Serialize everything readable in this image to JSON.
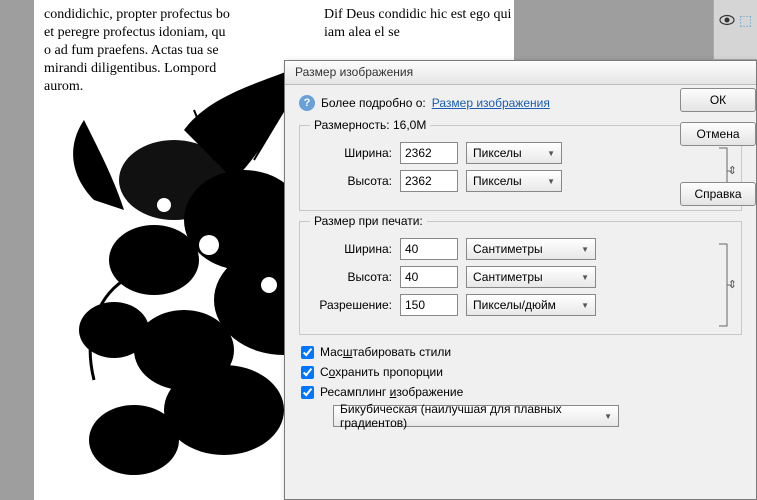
{
  "dialog": {
    "title": "Размер изображения",
    "info_prefix": "Более подробно о:",
    "info_link": "Размер изображения",
    "dim": {
      "legend_prefix": "Размерность:",
      "size": "16,0M",
      "width_label": "Ширина:",
      "width_value": "2362",
      "width_unit": "Пикселы",
      "height_label": "Высота:",
      "height_value": "2362",
      "height_unit": "Пикселы"
    },
    "print": {
      "legend": "Размер при печати:",
      "width_label": "Ширина:",
      "width_value": "40",
      "width_unit": "Сантиметры",
      "height_label": "Высота:",
      "height_value": "40",
      "height_unit": "Сантиметры",
      "res_label": "Разрешение:",
      "res_value": "150",
      "res_unit": "Пикселы/дюйм"
    },
    "scale_styles": "Масштабировать стили",
    "constrain": "Сохранить пропорции",
    "resample": "Ресамплинг изображение",
    "resample_method": "Бикубическая (наилучшая для плавных градиентов)"
  },
  "buttons": {
    "ok": "ОК",
    "cancel": "Отмена",
    "help": "Справка"
  },
  "underline": {
    "scale_u": "ш",
    "constrain_u": "о",
    "resample_u": "и"
  }
}
